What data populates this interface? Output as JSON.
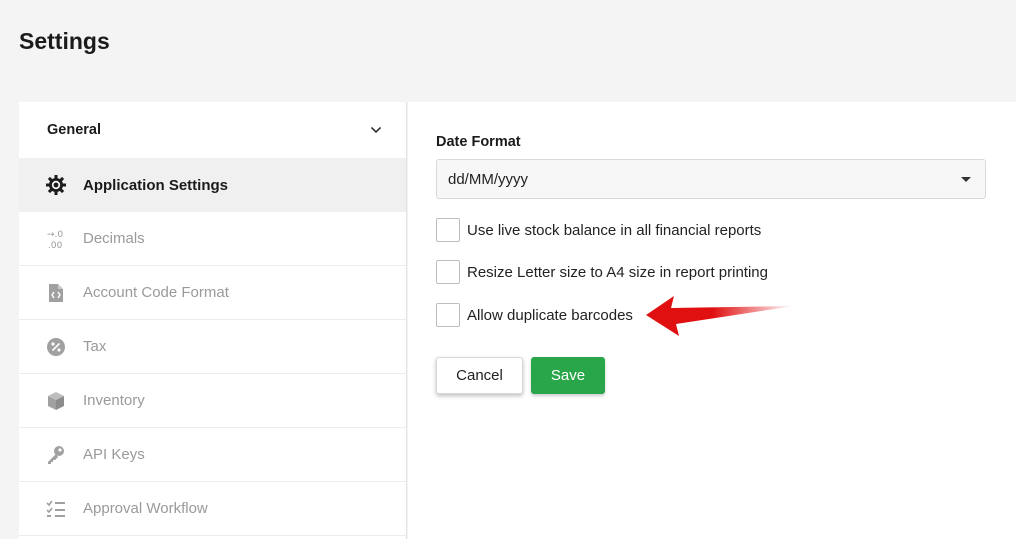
{
  "page": {
    "title": "Settings"
  },
  "sidebar": {
    "section_label": "General",
    "items": [
      {
        "label": "Application Settings",
        "icon": "gear-icon",
        "active": true
      },
      {
        "label": "Decimals",
        "icon": "decimals-icon"
      },
      {
        "label": "Account Code Format",
        "icon": "code-file-icon"
      },
      {
        "label": "Tax",
        "icon": "percent-icon"
      },
      {
        "label": "Inventory",
        "icon": "box-icon"
      },
      {
        "label": "API Keys",
        "icon": "key-icon"
      },
      {
        "label": "Approval Workflow",
        "icon": "checklist-icon"
      }
    ]
  },
  "form": {
    "date_format_label": "Date Format",
    "date_format_value": "dd/MM/yyyy",
    "options": [
      {
        "label": "Use live stock balance in all financial reports",
        "checked": false
      },
      {
        "label": "Resize Letter size to A4 size in report printing",
        "checked": false
      },
      {
        "label": "Allow duplicate barcodes",
        "checked": false
      }
    ],
    "cancel_label": "Cancel",
    "save_label": "Save"
  },
  "colors": {
    "accent_save": "#2aa64a",
    "annotation_arrow": "#e01010"
  }
}
